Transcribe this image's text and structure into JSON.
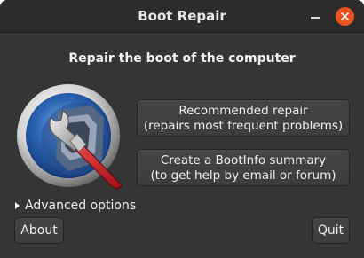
{
  "window": {
    "title": "Boot Repair",
    "controls": [
      "minimize-icon",
      "close-icon"
    ],
    "accent_color": "#e95420"
  },
  "main": {
    "heading": "Repair the boot of the computer",
    "logo_icon": "boot-repair-wrench-logo-icon",
    "recommended_repair": {
      "line1": "Recommended repair",
      "line2": "(repairs most frequent problems)"
    },
    "bootinfo_summary": {
      "line1": "Create a BootInfo summary",
      "line2": "(to get help by email or forum)"
    },
    "advanced_options": {
      "label": "Advanced options",
      "expanded": false
    }
  },
  "footer": {
    "about_label": "About",
    "quit_label": "Quit"
  }
}
